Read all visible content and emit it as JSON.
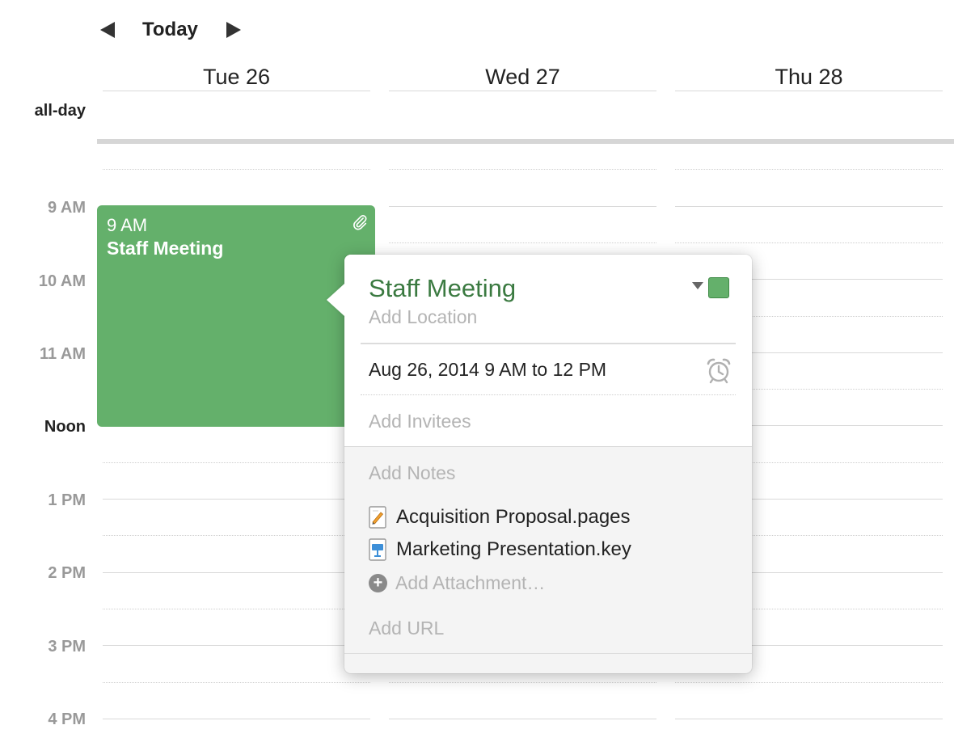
{
  "nav": {
    "today_label": "Today"
  },
  "days": [
    {
      "label": "Tue 26"
    },
    {
      "label": "Wed 27"
    },
    {
      "label": "Thu 28"
    }
  ],
  "allday_label": "all-day",
  "time_labels": [
    "9 AM",
    "10 AM",
    "11 AM",
    "Noon",
    "1 PM",
    "2 PM",
    "3 PM",
    "4 PM"
  ],
  "event": {
    "time": "9 AM",
    "title": "Staff Meeting",
    "color": "#64b06b"
  },
  "popover": {
    "title": "Staff Meeting",
    "location_placeholder": "Add Location",
    "date_range": "Aug 26, 2014  9 AM to 12 PM",
    "invitees_placeholder": "Add Invitees",
    "notes_placeholder": "Add Notes",
    "attachments": [
      {
        "name": "Acquisition Proposal.pages",
        "icon": "pages-file-icon"
      },
      {
        "name": "Marketing Presentation.key",
        "icon": "keynote-file-icon"
      }
    ],
    "add_attachment_label": "Add Attachment…",
    "url_placeholder": "Add URL",
    "title_color": "#3b7a41"
  }
}
